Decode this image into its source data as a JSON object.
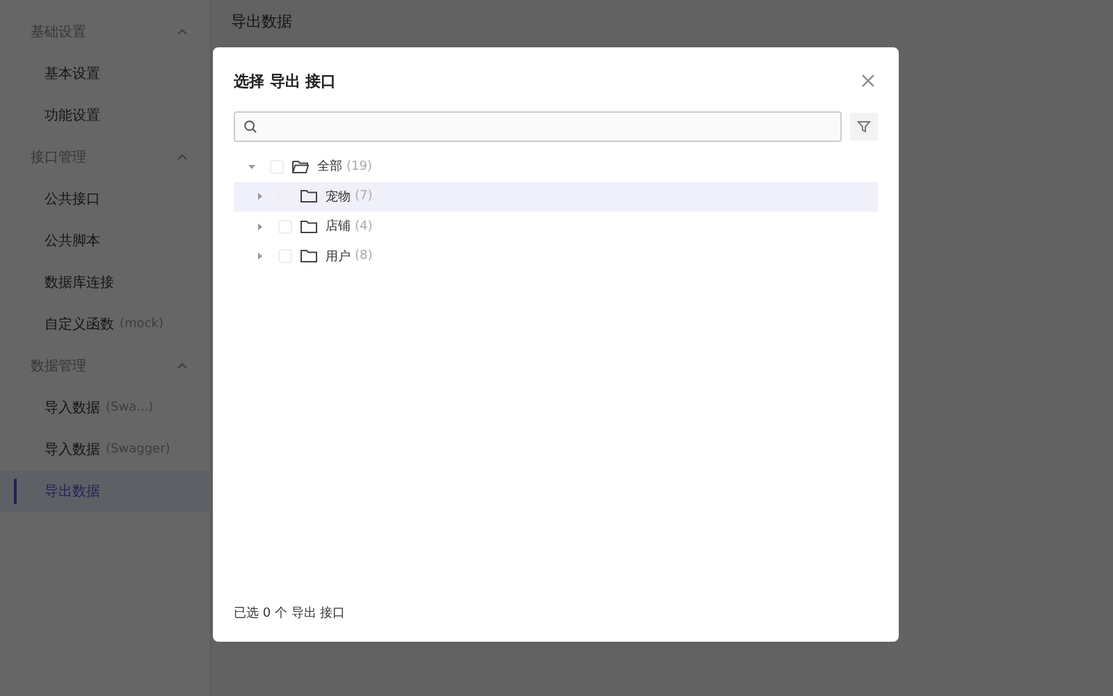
{
  "sidebar": {
    "groups": [
      {
        "title": "基础设置",
        "expanded": true,
        "items": [
          {
            "label": "基本设置",
            "selected": false
          },
          {
            "label": "功能设置",
            "selected": false
          }
        ]
      },
      {
        "title": "接口管理",
        "expanded": true,
        "items": [
          {
            "label": "公共接口",
            "selected": false
          },
          {
            "label": "公共脚本",
            "selected": false
          },
          {
            "label": "数据库连接",
            "selected": false
          },
          {
            "label": "自定义函数",
            "note": "(mock)",
            "selected": false
          }
        ]
      },
      {
        "title": "数据管理",
        "expanded": true,
        "items": [
          {
            "label": "导入数据",
            "note": "(Swa...)",
            "selected": false
          },
          {
            "label": "导入数据",
            "note": "(Swagger)",
            "selected": false
          },
          {
            "label": "导出数据",
            "selected": true
          }
        ]
      }
    ]
  },
  "page": {
    "title": "导出数据"
  },
  "dialog": {
    "title": "选择 导出 接口",
    "tree": [
      {
        "label": "全部",
        "count": "(19)",
        "expanded": true,
        "selected": false,
        "checked": false,
        "children": [
          {
            "label": "宠物",
            "count": "(7)",
            "expanded": false,
            "selected": true,
            "checked": false
          },
          {
            "label": "店铺",
            "count": "(4)",
            "expanded": false,
            "selected": false,
            "checked": false
          },
          {
            "label": "用户",
            "count": "(8)",
            "expanded": false,
            "selected": false,
            "checked": false
          }
        ]
      }
    ],
    "footer": "已选 0 个 导出 接口"
  }
}
